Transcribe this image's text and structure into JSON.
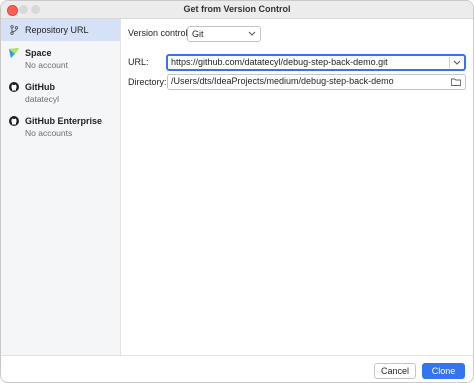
{
  "window": {
    "title": "Get from Version Control"
  },
  "sidebar": {
    "items": [
      {
        "label": "Repository URL",
        "sub": "",
        "icon": "vcs-branch-icon",
        "selected": true
      },
      {
        "label": "Space",
        "sub": "No account",
        "icon": "space-icon",
        "selected": false
      },
      {
        "label": "GitHub",
        "sub": "datatecyl",
        "icon": "github-icon",
        "selected": false
      },
      {
        "label": "GitHub Enterprise",
        "sub": "No accounts",
        "icon": "github-icon",
        "selected": false
      }
    ]
  },
  "form": {
    "vcs_label": "Version control:",
    "vcs_value": "Git",
    "url_label": "URL:",
    "url_value": "https://github.com/datatecyl/debug-step-back-demo.git",
    "dir_label": "Directory:",
    "dir_value": "/Users/dts/IdeaProjects/medium/debug-step-back-demo"
  },
  "buttons": {
    "cancel": "Cancel",
    "clone": "Clone"
  },
  "colors": {
    "accent": "#3574f0",
    "selected_bg": "#d5e1f7",
    "close": "#fe5f57"
  }
}
